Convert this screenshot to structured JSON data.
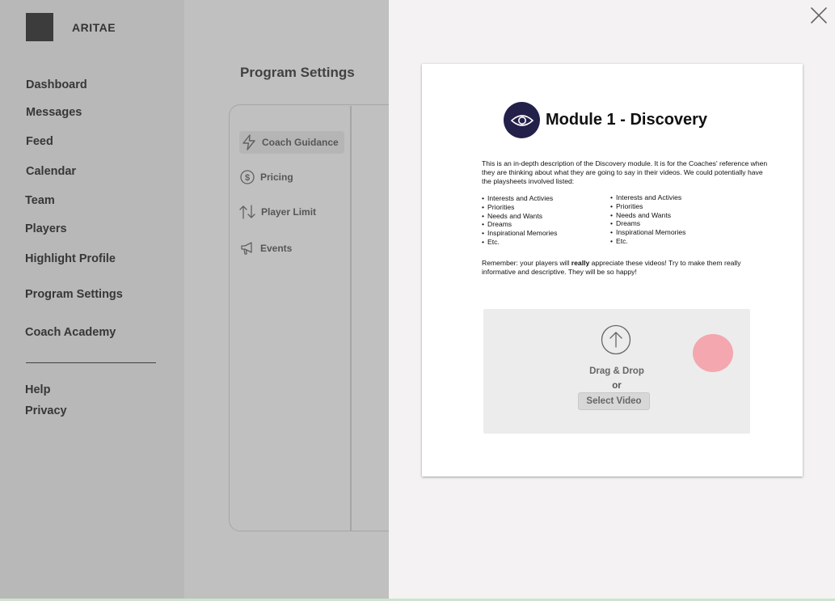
{
  "app": {
    "brand": "ARITAE"
  },
  "sidebar": {
    "items": [
      {
        "label": "Dashboard"
      },
      {
        "label": "Messages"
      },
      {
        "label": "Feed"
      },
      {
        "label": "Calendar"
      },
      {
        "label": "Team"
      },
      {
        "label": "Players"
      },
      {
        "label": "Highlight Profile"
      },
      {
        "label": "Program Settings"
      },
      {
        "label": "Coach Academy"
      }
    ],
    "footer": [
      {
        "label": "Help"
      },
      {
        "label": "Privacy"
      }
    ]
  },
  "page": {
    "title": "Program Settings"
  },
  "settings_menu": [
    {
      "label": "Coach Guidance",
      "icon": "lightning-icon",
      "active": true
    },
    {
      "label": "Pricing",
      "icon": "dollar-circle-icon",
      "active": false
    },
    {
      "label": "Player Limit",
      "icon": "up-down-arrows-icon",
      "active": false
    },
    {
      "label": "Events",
      "icon": "megaphone-icon",
      "active": false
    }
  ],
  "module": {
    "title": "Module 1 - Discovery",
    "badge_icon": "eye-icon",
    "badge_color": "#23204a",
    "description": "This is an in-depth description of the Discovery module. It is for the Coaches' reference when they are thinking about what they are going to say in their videos. We could potentially have the playsheets involved listed:",
    "list_left": [
      "Interests and Activies",
      "Priorities",
      "Needs and Wants",
      "Dreams",
      "Inspirational Memories",
      "Etc."
    ],
    "list_right": [
      "Interests and Activies",
      "Priorities",
      "Needs and Wants",
      "Dreams",
      "Inspirational Memories",
      "Etc."
    ],
    "remember_prefix": "Remember: your players will ",
    "remember_bold": "really",
    "remember_suffix": " appreciate these videos! Try to make them really informative and descriptive. They will be so happy!"
  },
  "upload": {
    "icon": "upload-arrow-icon",
    "drag_text": "Drag & Drop",
    "or_text": "or",
    "button_label": "Select Video"
  },
  "drawer": {
    "close_icon": "close-icon"
  }
}
